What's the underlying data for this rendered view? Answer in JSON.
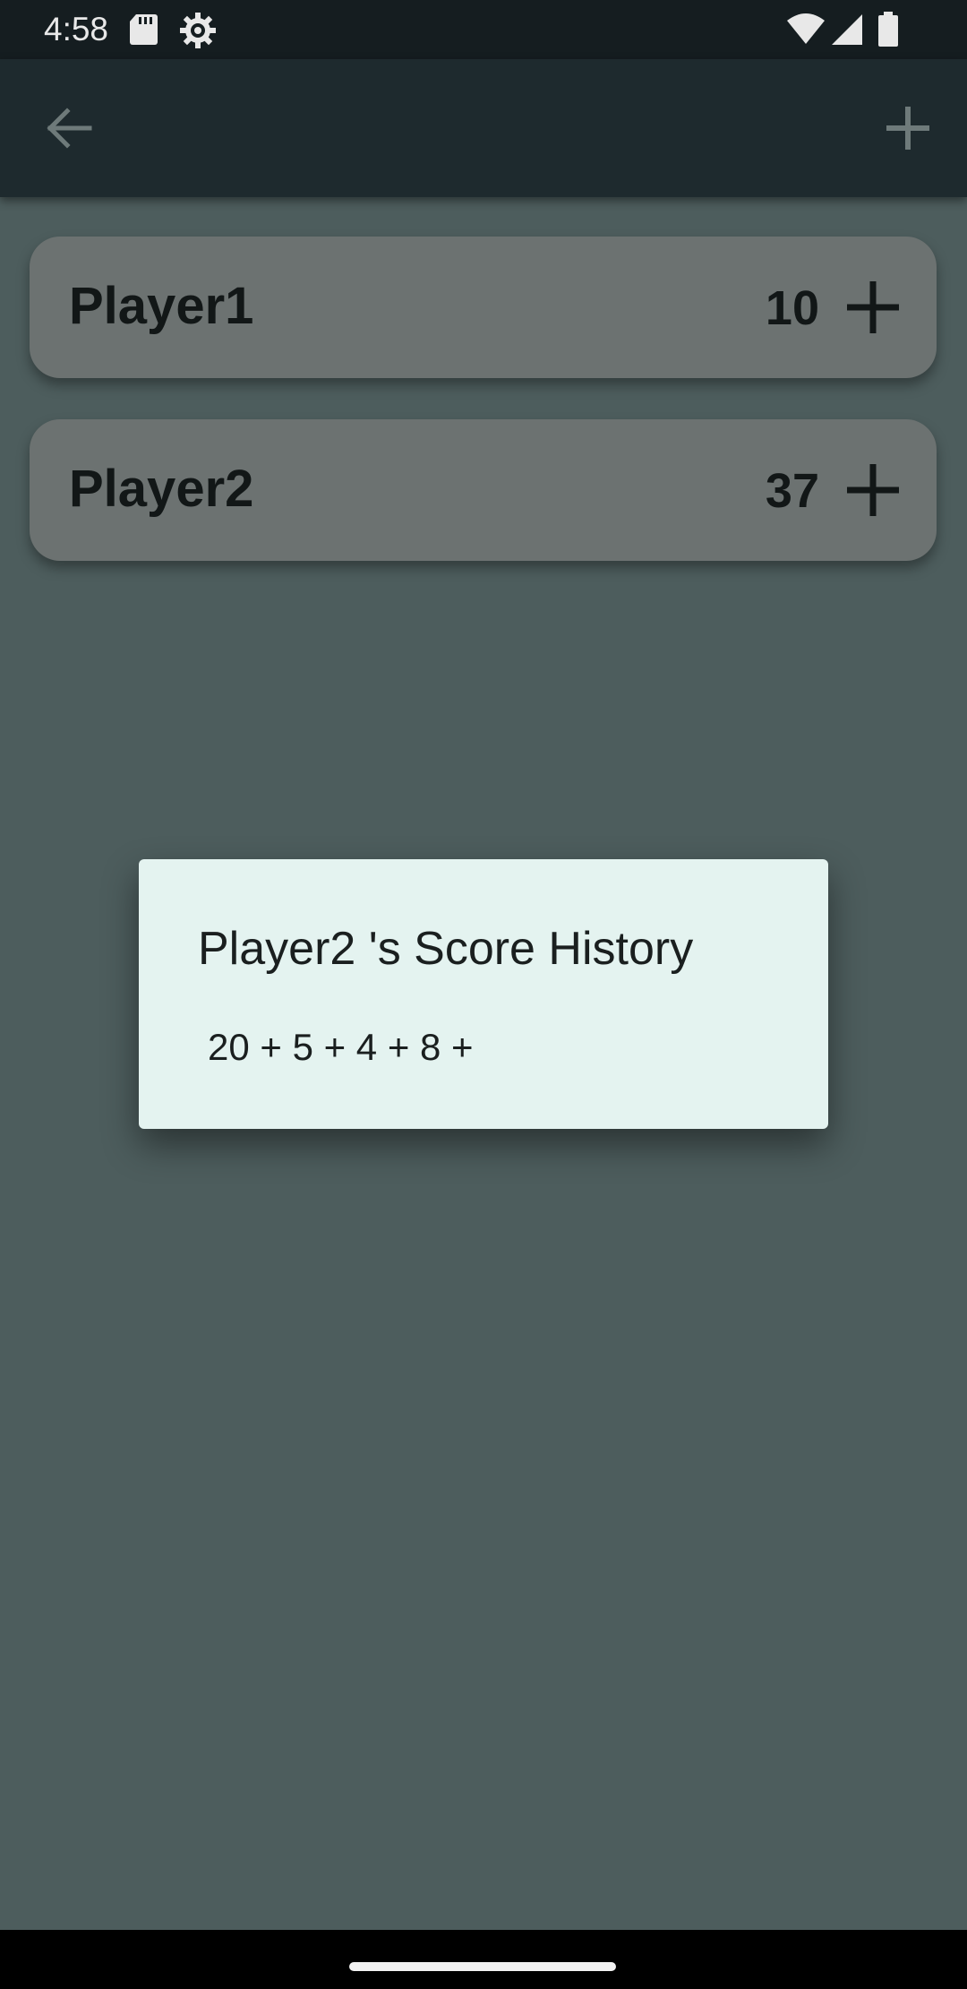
{
  "status_bar": {
    "time": "4:58",
    "left_icons": [
      "sd-card-icon",
      "settings-gear-icon"
    ],
    "right_icons": [
      "wifi-icon",
      "signal-icon",
      "battery-icon"
    ]
  },
  "app_bar": {
    "back_icon": "back-arrow-icon",
    "add_icon": "plus-icon"
  },
  "players": [
    {
      "name": "Player1",
      "score": "10"
    },
    {
      "name": "Player2",
      "score": "37"
    }
  ],
  "dialog": {
    "title": "Player2 's Score History",
    "history": "20 + 5 + 4 + 8 +"
  },
  "colors": {
    "dimmed_background": "#4d5d5d",
    "card": "#6c7271",
    "dialog": "#e4f3f0",
    "app_bar": "#1e2a2e"
  }
}
